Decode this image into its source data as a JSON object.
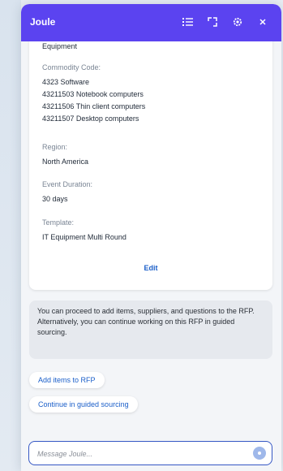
{
  "header": {
    "title": "Joule",
    "icons": [
      "history-icon",
      "expand-icon",
      "settings-icon",
      "close-icon"
    ]
  },
  "card": {
    "top_value": "Equipment",
    "commodity_label": "Commodity Code:",
    "commodity_values": [
      "4323 Software",
      "43211503 Notebook computers",
      "43211506 Thin client computers",
      "43211507 Desktop computers"
    ],
    "region_label": "Region:",
    "region_value": "North America",
    "duration_label": "Event Duration:",
    "duration_value": "30 days",
    "template_label": "Template:",
    "template_value": "IT Equipment Multi Round",
    "edit_label": "Edit"
  },
  "message": {
    "text": "You can proceed to add items, suppliers, and questions to the RFP. Alternatively, you can continue working on this RFP in guided sourcing."
  },
  "actions": {
    "add_items": "Add items to RFP",
    "continue_guided": "Continue in guided sourcing"
  },
  "composer": {
    "placeholder": "Message Joule..."
  },
  "colors": {
    "header": "#5b43f0",
    "link": "#1b5fc9",
    "input_border": "#3557c4"
  }
}
